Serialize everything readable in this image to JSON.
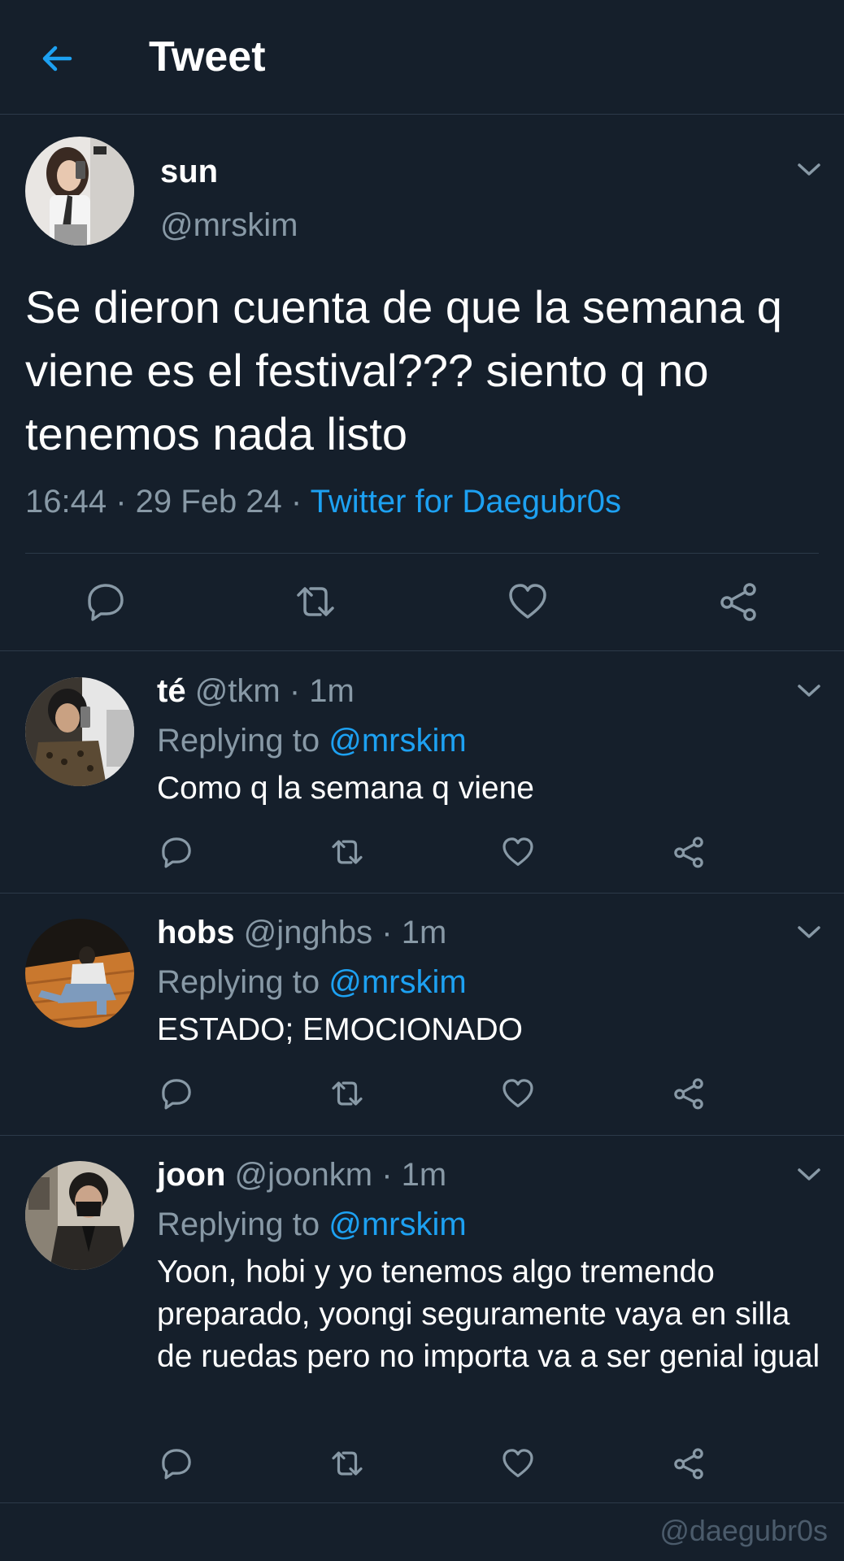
{
  "header": {
    "title": "Tweet",
    "back_icon": "arrow-left-icon",
    "accent": "#1da1f2"
  },
  "main_tweet": {
    "name": "sun",
    "handle": "@mrskim",
    "text": "Se dieron cuenta de que la semana q viene es el festival??? siento q no tenemos nada listo",
    "time": "16:44",
    "date": "29 Feb 24",
    "source": "Twitter for Daegubr0s"
  },
  "replies": [
    {
      "name": "té",
      "handle": "@tkm",
      "time": "1m",
      "replying_label": "Replying to",
      "replying_handle": "@mrskim",
      "text": "Como q la semana q viene"
    },
    {
      "name": "hobs",
      "handle": "@jnghbs",
      "time": "1m",
      "replying_label": "Replying to",
      "replying_handle": "@mrskim",
      "text": "ESTADO; EMOCIONADO"
    },
    {
      "name": "joon",
      "handle": "@joonkm",
      "time": "1m",
      "replying_label": "Replying to",
      "replying_handle": "@mrskim",
      "text": "Yoon, hobi y yo tenemos algo tremendo preparado, yoongi seguramente vaya en silla de ruedas pero no importa va a ser genial igual"
    }
  ],
  "watermark": "@daegubr0s",
  "colors": {
    "background": "#151f2b",
    "muted": "#8899a6",
    "divider": "#2c3a49",
    "link": "#1da1f2"
  }
}
